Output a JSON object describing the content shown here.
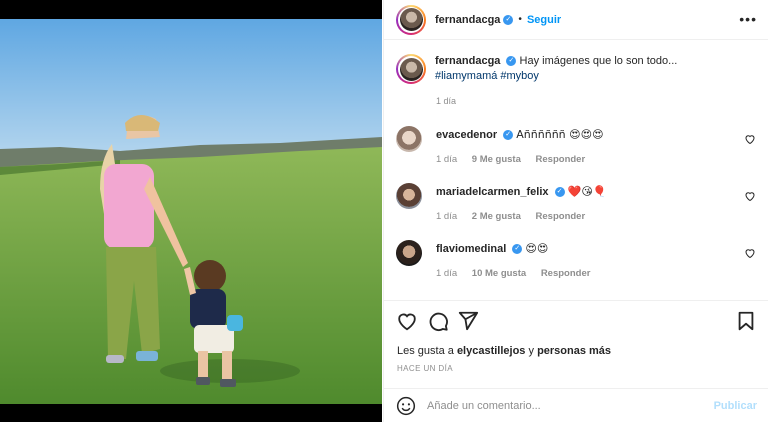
{
  "post": {
    "username": "fernandacga",
    "follow_label": "Seguir",
    "more_label": "•••",
    "caption_text": "Hay imágenes que lo son todo...",
    "hashtags": "#liamymamá #myboy",
    "caption_time": "1 día"
  },
  "comments": [
    {
      "username": "evacedenor",
      "text": "Aññññññ 😍😍😍",
      "time": "1 día",
      "likes": "9 Me gusta",
      "reply": "Responder"
    },
    {
      "username": "mariadelcarmen_felix",
      "text": "❤️😘🎈",
      "time": "1 día",
      "likes": "2 Me gusta",
      "reply": "Responder"
    },
    {
      "username": "flaviomedinal",
      "text": "😍😍",
      "time": "1 día",
      "likes": "10 Me gusta",
      "reply": "Responder"
    }
  ],
  "likes": {
    "prefix": "Les gusta a",
    "user": "elycastillejos",
    "conj": "y",
    "others": "personas más"
  },
  "posted_ago": "HACE UN DÍA",
  "comment_box": {
    "placeholder": "Añade un comentario...",
    "publish_label": "Publicar"
  },
  "colors": {
    "link_blue": "#0095f6",
    "hashtag": "#00376b",
    "muted": "#8e8e8e",
    "publish_disabled": "#b2dffc",
    "verified": "#3897f0"
  },
  "icons": [
    "more-options-icon",
    "verified-badge-icon",
    "heart-icon",
    "comment-icon",
    "share-icon",
    "bookmark-icon",
    "emoji-icon"
  ]
}
